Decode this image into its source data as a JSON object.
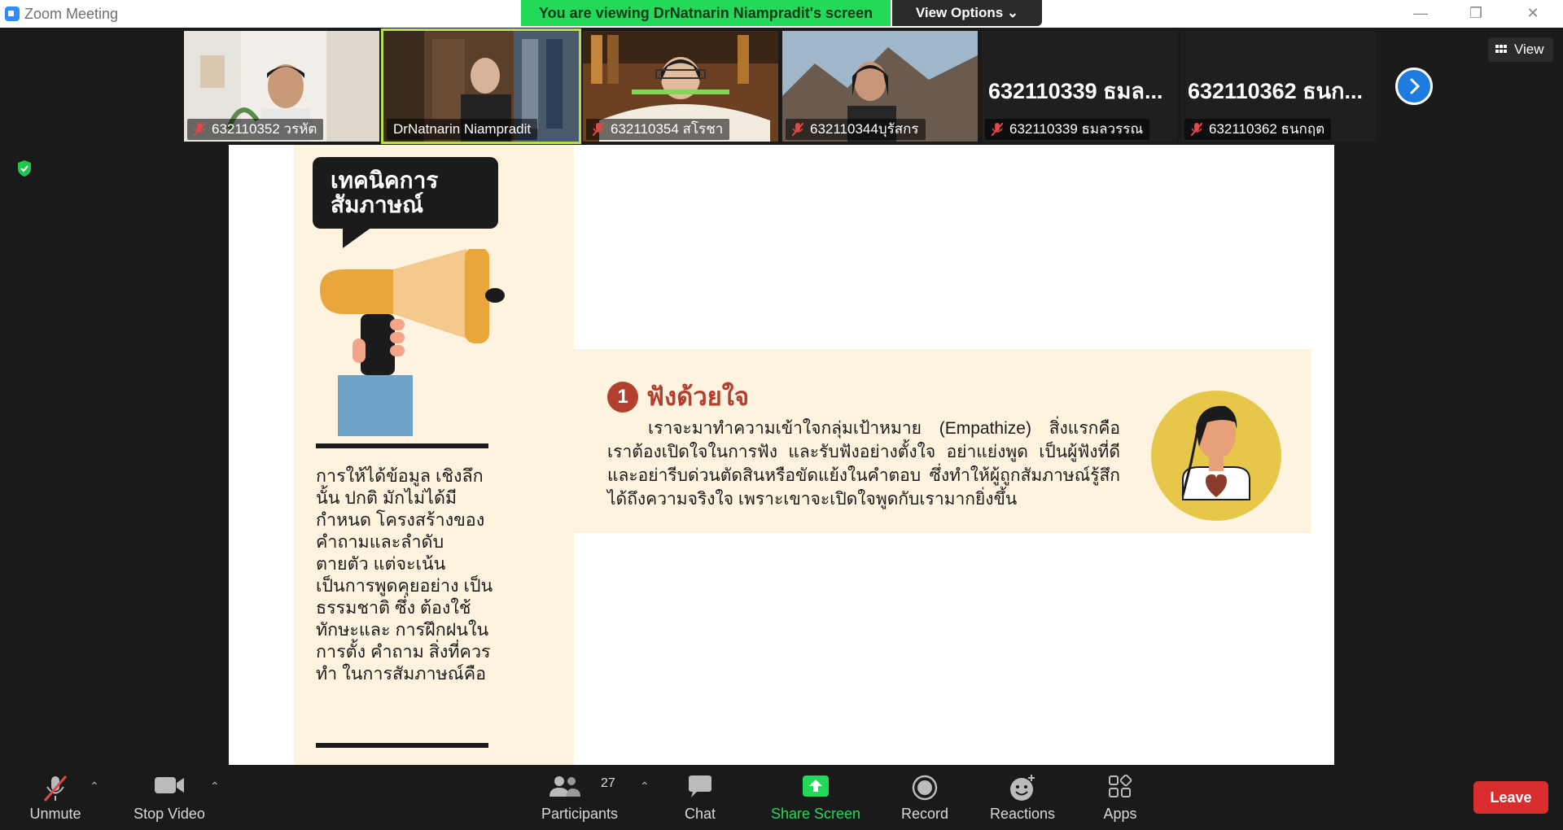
{
  "window": {
    "title": "Zoom Meeting",
    "viewing_banner": "You are viewing DrNatnarin Niampradit's screen",
    "view_options": "View Options",
    "view_button": "View"
  },
  "participants_strip": [
    {
      "name": "632110352 วรหัต",
      "muted": true,
      "video": true
    },
    {
      "name": "DrNatnarin Niampradit",
      "muted": false,
      "video": true,
      "active_speaker": true
    },
    {
      "name": "632110354 สโรชา",
      "muted": true,
      "video": true
    },
    {
      "name": "632110344บุรัสกร",
      "muted": true,
      "video": true
    },
    {
      "name": "632110339 ธมลวรรณ",
      "display": "632110339 ธมล...",
      "muted": true,
      "video": false
    },
    {
      "name": "632110362 ธนกฤต",
      "display": "632110362 ธนก...",
      "muted": true,
      "video": false
    }
  ],
  "slide": {
    "tag_line1": "เทคนิคการ",
    "tag_line2": "สัมภาษณ์",
    "left_text": "การให้ได้ข้อมูล เชิงลึกนั้น ปกติ มักไม่ได้มีกำหนด โครงสร้างของ คำถามและลำดับ ตายตัว แต่จะเน้น เป็นการพูดคุยอย่าง เป็นธรรมชาติ ซึ่ง ต้องใช้ทักษะและ การฝึกฝนในการตั้ง คำถาม สิ่งที่ควรทำ ในการสัมภาษณ์คือ",
    "number": "1",
    "heading": "ฟังด้วยใจ",
    "body": "เราจะมาทำความเข้าใจกลุ่มเป้าหมาย (Empathize) สิ่งแรกคือ เราต้องเปิดใจในการฟัง และรับฟังอย่างตั้งใจ อย่าแย่งพูด เป็นผู้ฟังที่ดี และอย่ารีบด่วนตัดสินหรือขัดแย้งในคำตอบ ซึ่งทำให้ผู้ถูกสัมภาษณ์รู้สึก ได้ถึงความจริงใจ เพราะเขาจะเปิดใจพูดกับเรามากยิ่งขึ้น"
  },
  "toolbar": {
    "unmute": "Unmute",
    "stop_video": "Stop Video",
    "participants": "Participants",
    "participants_count": "27",
    "chat": "Chat",
    "share_screen": "Share Screen",
    "record": "Record",
    "reactions": "Reactions",
    "apps": "Apps",
    "leave": "Leave"
  },
  "colors": {
    "banner_green": "#23d959",
    "share_green": "#23d959",
    "leave_red": "#d92d2d",
    "accent_blue": "#1f7ae0",
    "slide_cream": "#fdf3de",
    "heading_red": "#b3402f"
  }
}
